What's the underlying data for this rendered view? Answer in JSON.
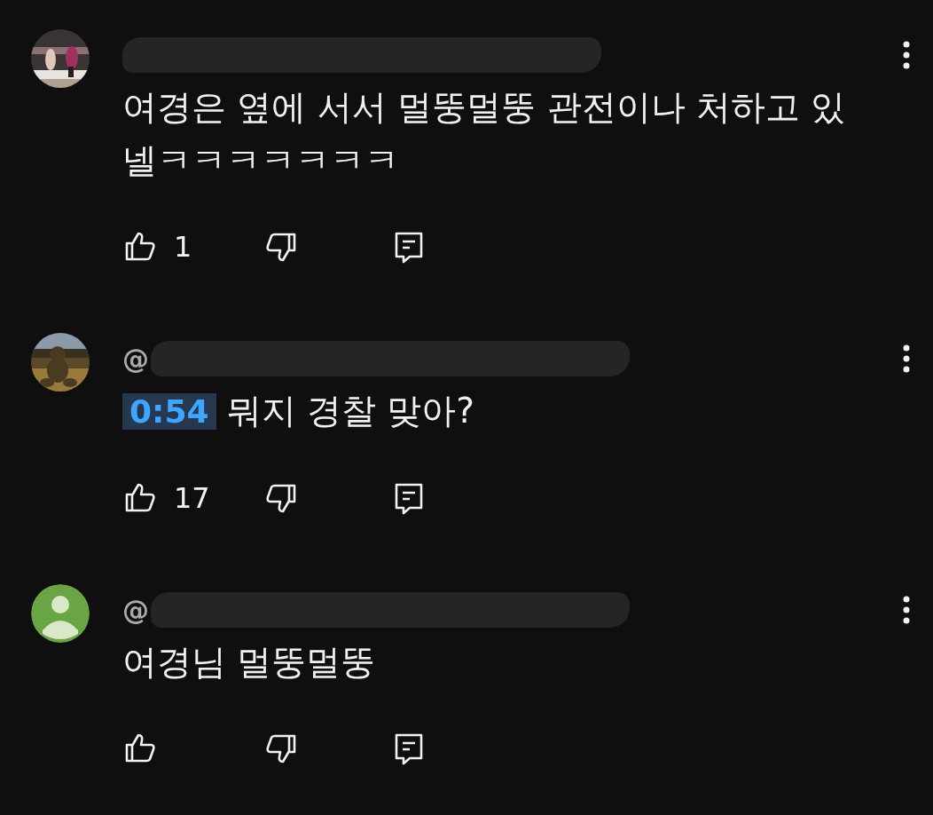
{
  "comments": [
    {
      "redacted": true,
      "text": "여경은 옆에 서서 멀뚱멀뚱 관전이나 처하고 있넬ㅋㅋㅋㅋㅋㅋㅋ",
      "likes": "1"
    },
    {
      "handle": "@",
      "redacted": true,
      "timestamp": "0:54",
      "text": "뭐지 경찰 맞아?",
      "likes": "17"
    },
    {
      "avatar": {
        "kind": "default",
        "color": "#6aa545"
      },
      "handle": "@",
      "redacted": true,
      "text": "여경님 멀뚱멀뚱"
    }
  ]
}
